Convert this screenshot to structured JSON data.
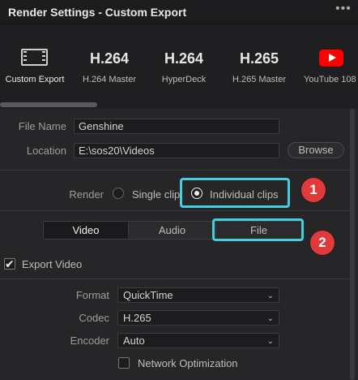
{
  "window": {
    "title": "Render Settings - Custom Export",
    "more_icon": "more-dots-icon"
  },
  "presets": [
    {
      "big": "",
      "label": "Custom Export",
      "icon": "film-strip-icon",
      "selected": true
    },
    {
      "big": "H.264",
      "label": "H.264 Master"
    },
    {
      "big": "H.264",
      "label": "HyperDeck"
    },
    {
      "big": "H.265",
      "label": "H.265 Master"
    },
    {
      "big": "",
      "label": "YouTube 108",
      "icon": "youtube-icon"
    }
  ],
  "file": {
    "name_label": "File Name",
    "name_value": "Genshine",
    "location_label": "Location",
    "location_value": "E:\\sos20\\Videos",
    "browse_label": "Browse"
  },
  "render": {
    "label": "Render",
    "options": [
      "Single clip",
      "Individual clips"
    ],
    "selected": "Individual clips"
  },
  "tabs": {
    "items": [
      "Video",
      "Audio",
      "File"
    ],
    "active": "Video"
  },
  "annotations": {
    "badge1": "1",
    "badge2": "2",
    "highlight_color": "#45cde0",
    "badge_color": "#e03a3a"
  },
  "video": {
    "export_label": "Export Video",
    "export_checked": true,
    "format_label": "Format",
    "format_value": "QuickTime",
    "codec_label": "Codec",
    "codec_value": "H.265",
    "encoder_label": "Encoder",
    "encoder_value": "Auto",
    "network_opt_label": "Network Optimization",
    "network_opt_checked": false
  }
}
